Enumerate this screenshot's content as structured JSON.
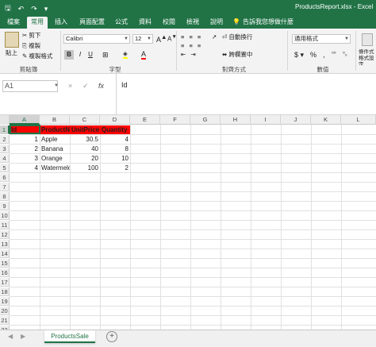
{
  "titlebar": {
    "doc_title": "ProductsReport.xlsx  -  Excel"
  },
  "tabs": [
    "檔案",
    "常用",
    "插入",
    "頁面配置",
    "公式",
    "資料",
    "校閱",
    "檢視",
    "說明"
  ],
  "tellme": "告訴我您想做什麼",
  "ribbon": {
    "paste": "貼上",
    "cut": "剪下",
    "copy": "複製",
    "format_painter": "複製格式",
    "clipboard_label": "剪貼簿",
    "font_name": "Calibri",
    "font_size": "12",
    "font_label": "字型",
    "wrap_text": "自動換行",
    "merge_center": "跨欄置中",
    "alignment_label": "對齊方式",
    "number_format": "通用格式",
    "number_label": "數值",
    "cond_format": "條件式格式設定"
  },
  "colors": {
    "accent": "#217346",
    "header_fill": "#ff0000"
  },
  "formula": {
    "namebox": "A1",
    "cancel": "×",
    "enter": "✓",
    "fx": "fx",
    "content": "Id"
  },
  "columns": [
    "A",
    "B",
    "C",
    "D",
    "E",
    "F",
    "G",
    "H",
    "I",
    "J",
    "K",
    "L"
  ],
  "rows": [
    "1",
    "2",
    "3",
    "4",
    "5",
    "6",
    "7",
    "8",
    "9",
    "10",
    "11",
    "12",
    "13",
    "14",
    "15",
    "16",
    "17",
    "18",
    "19",
    "20",
    "21",
    "22",
    "23"
  ],
  "table": {
    "headers": [
      "Id",
      "ProductName",
      "UnitPrice",
      "Quantity"
    ],
    "rows": [
      [
        "1",
        "Apple",
        "30.5",
        "4"
      ],
      [
        "2",
        "Banana",
        "40",
        "8"
      ],
      [
        "3",
        "Orange",
        "20",
        "10"
      ],
      [
        "4",
        "Watermelon",
        "100",
        "2"
      ]
    ]
  },
  "sheet": {
    "tab": "ProductsSale",
    "add": "+"
  }
}
